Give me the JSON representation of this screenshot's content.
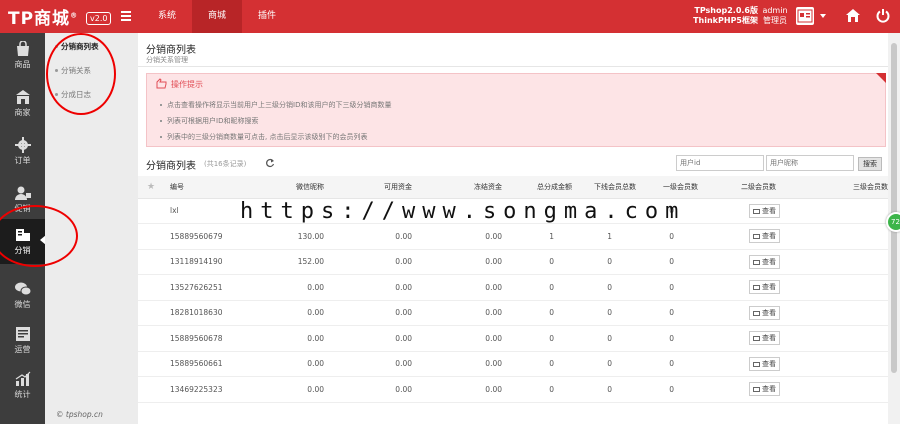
{
  "header": {
    "logo": "TP商城",
    "logo_mark": "®",
    "version": "v2.0",
    "nav": [
      "系统",
      "商城",
      "插件"
    ],
    "active_nav": 1,
    "version_info_line1": "TPshop2.0.6版",
    "version_info_line2": "ThinkPHP5框架",
    "user_line1": "admin",
    "user_line2": "管理员"
  },
  "left_nav": [
    {
      "label": "商品",
      "icon": "bag-icon"
    },
    {
      "label": "商家",
      "icon": "store-icon"
    },
    {
      "label": "订单",
      "icon": "gear-icon"
    },
    {
      "label": "促销",
      "icon": "user-promo-icon"
    },
    {
      "label": "分销",
      "icon": "distribution-icon",
      "active": true
    },
    {
      "label": "微信",
      "icon": "wechat-icon"
    },
    {
      "label": "运营",
      "icon": "operation-icon"
    },
    {
      "label": "统计",
      "icon": "chart-icon"
    }
  ],
  "sub_nav": [
    {
      "label": "分销商列表",
      "active": true
    },
    {
      "label": "分销关系"
    },
    {
      "label": "分成日志"
    }
  ],
  "footer_brand": "© tpshop.cn",
  "page": {
    "title": "分销商列表",
    "subtitle": "分销关系管理"
  },
  "tips": {
    "title": "操作提示",
    "lines": [
      "点击查看操作将显示当前用户上三级分销ID和该用户的下三级分销商数量",
      "列表可根据用户ID和昵称搜索",
      "列表中的三级分销商数量可点击, 点击后显示该级别下的会员列表"
    ]
  },
  "list": {
    "title": "分销商列表",
    "count": "(共16条记录)",
    "search_uid_placeholder": "用户id",
    "search_name_placeholder": "用户昵称",
    "search_button": "搜索",
    "columns": [
      "编号",
      "微信昵称",
      "可用资金",
      "冻结资金",
      "总分成金额",
      "下线会员总数",
      "一级会员数",
      "二级会员数",
      "三级会员数"
    ],
    "view_label": "查看",
    "rows": [
      [
        "lxl",
        "",
        "",
        "",
        "",
        "",
        "0",
        "",
        ""
      ],
      [
        "15889560679",
        "130.00",
        "0.00",
        "0.00",
        "1",
        "1",
        "0",
        "0",
        ""
      ],
      [
        "13118914190",
        "152.00",
        "0.00",
        "0.00",
        "0",
        "0",
        "0",
        "0",
        ""
      ],
      [
        "13527626251",
        "0.00",
        "0.00",
        "0.00",
        "0",
        "0",
        "0",
        "0",
        ""
      ],
      [
        "18281018630",
        "0.00",
        "0.00",
        "0.00",
        "0",
        "0",
        "0",
        "0",
        ""
      ],
      [
        "15889560678",
        "0.00",
        "0.00",
        "0.00",
        "0",
        "0",
        "0",
        "0",
        ""
      ],
      [
        "15889560661",
        "0.00",
        "0.00",
        "0.00",
        "0",
        "0",
        "0",
        "0",
        ""
      ],
      [
        "13469225323",
        "0.00",
        "0.00",
        "0.00",
        "0",
        "0",
        "0",
        "0",
        ""
      ]
    ]
  },
  "side_badge": "72",
  "watermark": "https://www.songma.com",
  "colors": {
    "brand": "#d43033",
    "sidebar": "#3d3d3d",
    "tip_bg": "#fde4e6",
    "tip_title": "#e14d55"
  }
}
